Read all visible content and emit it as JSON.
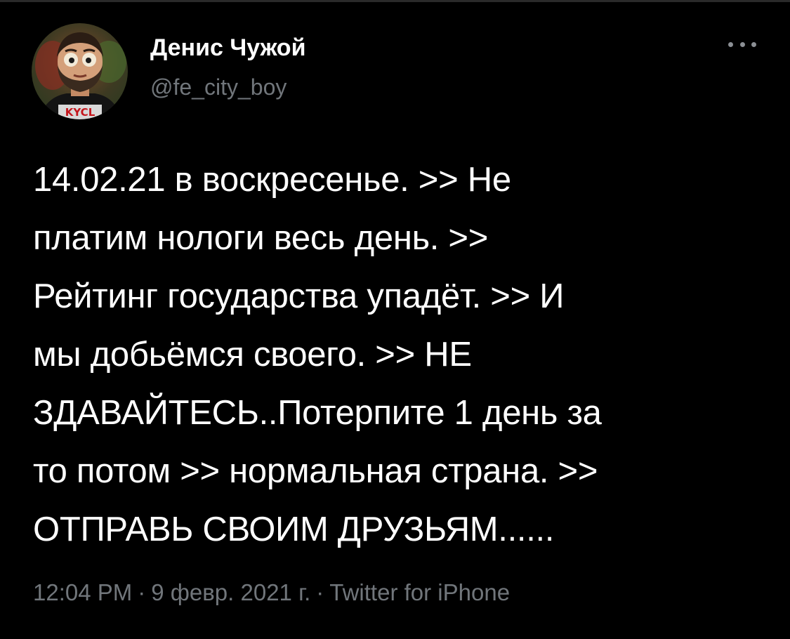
{
  "author": {
    "name": "Денис Чужой",
    "handle": "@fe_city_boy",
    "avatar_shirt_text": "KYCL"
  },
  "more_icon": "more-horizontal-icon",
  "tweet": {
    "lines": [
      "14.02.21 в воскресенье. >> Не",
      "платим нологи весь день. >>",
      "Рейтинг государства упадёт. >> И",
      "мы добьёмся своего. >> НЕ",
      "ЗДАВАЙТЕСЬ..Потерпите 1 день за",
      "то потом >> нормальная страна. >>",
      "ОТПРАВЬ СВОИМ ДРУЗЬЯМ......"
    ]
  },
  "meta": {
    "time": "12:04 PM",
    "separator": "·",
    "date": "9 февр. 2021 г.",
    "source": "Twitter for iPhone"
  },
  "colors": {
    "background": "#000000",
    "text": "#ffffff",
    "secondary": "#71767b"
  }
}
